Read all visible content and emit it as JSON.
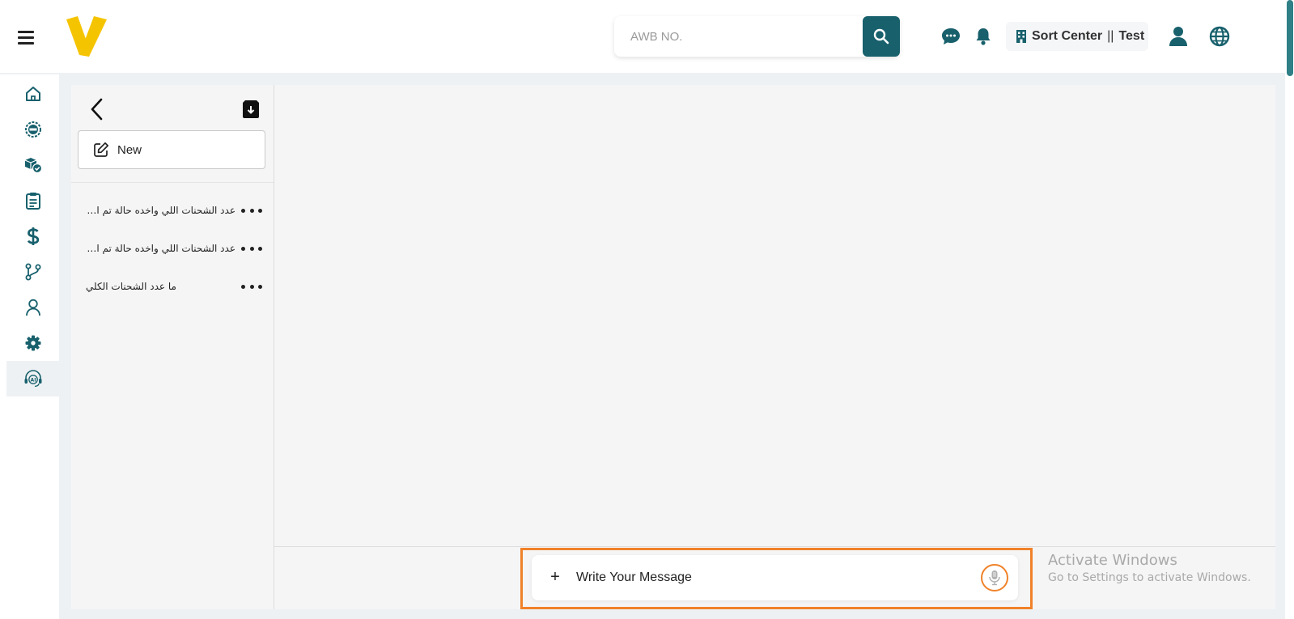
{
  "header": {
    "search_placeholder": "AWB NO.",
    "center_label": "Sort Center",
    "center_separator": "||",
    "center_env": "Test"
  },
  "sidebar": {
    "items": [
      {
        "icon": "home-icon"
      },
      {
        "icon": "new-badge-icon"
      },
      {
        "icon": "boxes-check-icon"
      },
      {
        "icon": "clipboard-icon"
      },
      {
        "icon": "dollar-icon"
      },
      {
        "icon": "branch-icon"
      },
      {
        "icon": "user-icon"
      },
      {
        "icon": "settings-icon"
      },
      {
        "icon": "ai-support-icon",
        "active": true
      }
    ]
  },
  "history": {
    "new_label": "New",
    "conversations": [
      {
        "title": "عدد الشحنات اللي واخده حالة تم التوصيلل"
      },
      {
        "title": "عدد الشحنات اللي واخده حالة تم التوصيلل"
      },
      {
        "title": "ما عدد الشحنات الكلي"
      }
    ]
  },
  "composer": {
    "attach_label": "+",
    "placeholder": "Write Your Message"
  },
  "watermark": {
    "line1": "Activate Windows",
    "line2": "Go to Settings to activate Windows."
  },
  "colors": {
    "accent": "#17606c",
    "brand_yellow": "#f5c400",
    "highlight": "#f0822a"
  }
}
